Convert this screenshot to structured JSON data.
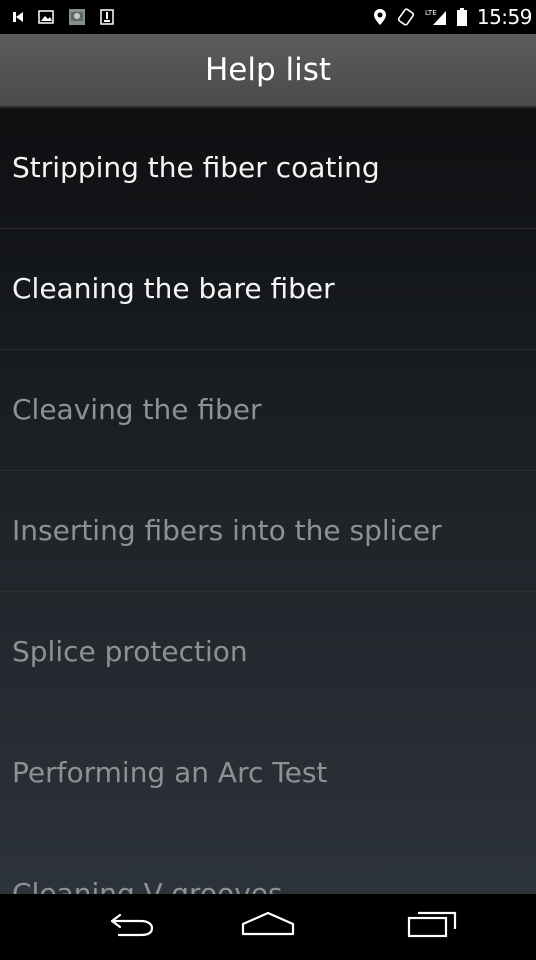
{
  "status_bar": {
    "icons_left": [
      "chevron-play-icon",
      "image-icon",
      "app-thumbnail-icon",
      "download-icon"
    ],
    "icons_right": [
      "location-pin-icon",
      "rotation-icon",
      "lte-signal-icon",
      "battery-icon"
    ],
    "lte_label": "LTE",
    "time": "15:59"
  },
  "action_bar": {
    "title": "Help list"
  },
  "help_list": {
    "items": [
      {
        "label": "Stripping the fiber coating",
        "state": "active"
      },
      {
        "label": "Cleaning the bare fiber",
        "state": "active"
      },
      {
        "label": "Cleaving the fiber",
        "state": "inactive"
      },
      {
        "label": "Inserting fibers into the splicer",
        "state": "inactive"
      },
      {
        "label": "Splice protection",
        "state": "inactive"
      },
      {
        "label": "Performing an Arc Test",
        "state": "inactive"
      },
      {
        "label": "Cleaning V-grooves",
        "state": "inactive"
      }
    ]
  },
  "nav_bar": {
    "buttons": [
      "back-icon",
      "home-icon",
      "recents-icon"
    ]
  },
  "colors": {
    "active_text": "#f4f4f4",
    "inactive_text": "#8c9196",
    "action_bar": "#545454"
  }
}
